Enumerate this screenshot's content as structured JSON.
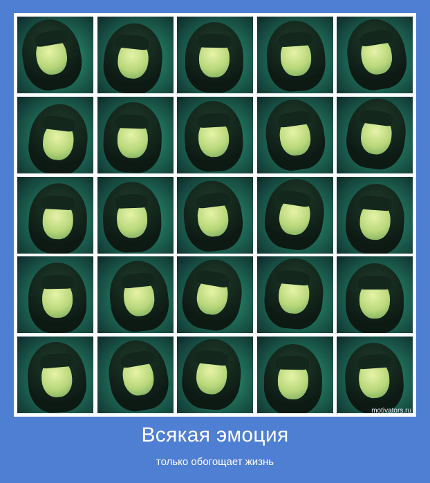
{
  "poster": {
    "title": "Всякая эмоция",
    "subtitle": "только обогощает жизнь",
    "watermark": "motivators.ru"
  },
  "colors": {
    "background": "#4f7fd2",
    "frame": "#ffffff",
    "text": "#ffffff"
  }
}
